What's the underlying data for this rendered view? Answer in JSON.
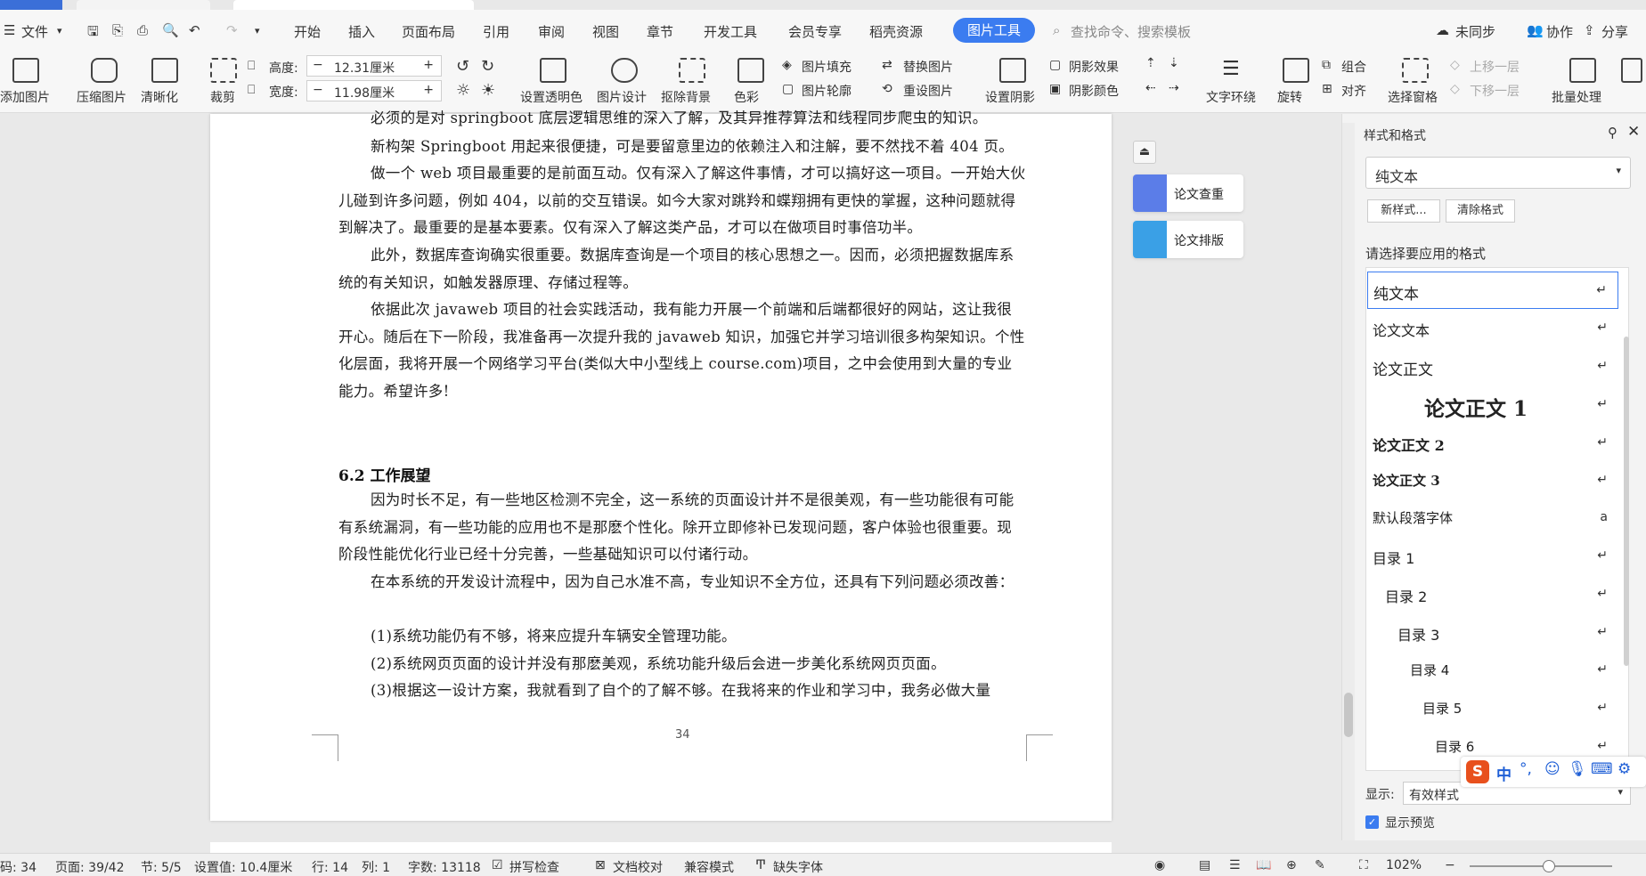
{
  "menubar": {
    "file": "文件",
    "tabs": [
      "开始",
      "插入",
      "页面布局",
      "引用",
      "审阅",
      "视图",
      "章节",
      "开发工具",
      "会员专享",
      "稻壳资源"
    ],
    "active_tab": "图片工具",
    "search_placeholder": "查找命令、搜索模板",
    "unsync": "未同步",
    "collab": "协作",
    "share": "分享"
  },
  "ribbon": {
    "add_image": "添加图片",
    "compress": "压缩图片",
    "sharpen": "清晰化",
    "crop": "裁剪",
    "height_label": "高度:",
    "height_value": "12.31厘米",
    "width_label": "宽度:",
    "width_value": "11.98厘米",
    "transparency": "设置透明色",
    "design": "图片设计",
    "remove_bg": "抠除背景",
    "color": "色彩",
    "fill": "图片填充",
    "outline": "图片轮廓",
    "replace": "替换图片",
    "reset": "重设图片",
    "shadow_set": "设置阴影",
    "shadow_effect": "阴影效果",
    "shadow_color": "阴影颜色",
    "text_wrap": "文字环绕",
    "rotate": "旋转",
    "group": "组合",
    "align": "对齐",
    "select_pane": "选择窗格",
    "bring_up": "上移一层",
    "send_down": "下移一层",
    "batch": "批量处理"
  },
  "document": {
    "top_line": "必须的是对 springboot 底层逻辑思维的深入了解，及其异推荐算法和线程同步爬虫的知识。",
    "p1": "新构架 Springboot 用起来很便捷，可是要留意里边的依赖注入和注解，要不然找不着 404 页。",
    "p2": "做一个 web 项目最重要的是前面互动。仅有深入了解这件事情，才可以搞好这一项目。一开始大伙儿碰到许多问题，例如 404，以前的交互错误。如今大家对跳羚和蝶翔拥有更快的掌握，这种问题就得到解决了。最重要的是基本要素。仅有深入了解这类产品，才可以在做项目时事倍功半。",
    "p3": "此外，数据库查询确实很重要。数据库查询是一个项目的核心思想之一。因而，必须把握数据库系统的有关知识，如触发器原理、存储过程等。",
    "p4": "依据此次 javaweb 项目的社会实践活动，我有能力开展一个前端和后端都很好的网站，这让我很开心。随后在下一阶段，我准备再一次提升我的 javaweb 知识，加强它并学习培训很多构架知识。个性化层面，我将开展一个网络学习平台(类似大中小型线上 course.com)项目，之中会使用到大量的专业能力。希望许多!",
    "heading": "6.2    工作展望",
    "p5": "因为时长不足，有一些地区检测不完全，这一系统的页面设计并不是很美观，有一些功能很有可能有系统漏洞，有一些功能的应用也不是那麽个性化。除开立即修补已发现问题，客户体验也很重要。现阶段性能优化行业已经十分完善，一些基础知识可以付诸行动。",
    "p6": "在本系统的开发设计流程中，因为自己水准不高，专业知识不全方位，还具有下列问题必须改善：",
    "l1": "(1)系统功能仍有不够，将来应提升车辆安全管理功能。",
    "l2": "(2)系统网页页面的设计并没有那麽美观，系统功能升级后会进一步美化系统网页页面。",
    "l3": "(3)根据这一设计方案，我就看到了自个的了解不够。在我将来的作业和学习中，我务必做大量",
    "page_number": "34"
  },
  "float_panel": {
    "check": "论文查重",
    "layout": "论文排版"
  },
  "styles_pane": {
    "title": "样式和格式",
    "current": "纯文本",
    "new_style": "新样式...",
    "clear_format": "清除格式",
    "prompt": "请选择要应用的格式",
    "items": [
      "纯文本",
      "论文文本",
      "论文正文",
      "论文正文 1",
      "论文正文 2",
      "论文正文 3",
      "默认段落字体",
      "目录 1",
      "目录 2",
      "目录 3",
      "目录 4",
      "目录 5",
      "目录 6"
    ],
    "show_label": "显示:",
    "show_value": "有效样式",
    "preview": "显示预览"
  },
  "statusbar": {
    "page_code": "码: 34",
    "page": "页面: 39/42",
    "section": "节: 5/5",
    "setting": "设置值: 10.4厘米",
    "row": "行: 14",
    "col": "列: 1",
    "words": "字数: 13118",
    "spell": "拼写检查",
    "proof": "文档校对",
    "compat": "兼容模式",
    "missing_font": "缺失字体",
    "zoom": "102%"
  },
  "ime": {
    "lang": "中"
  }
}
